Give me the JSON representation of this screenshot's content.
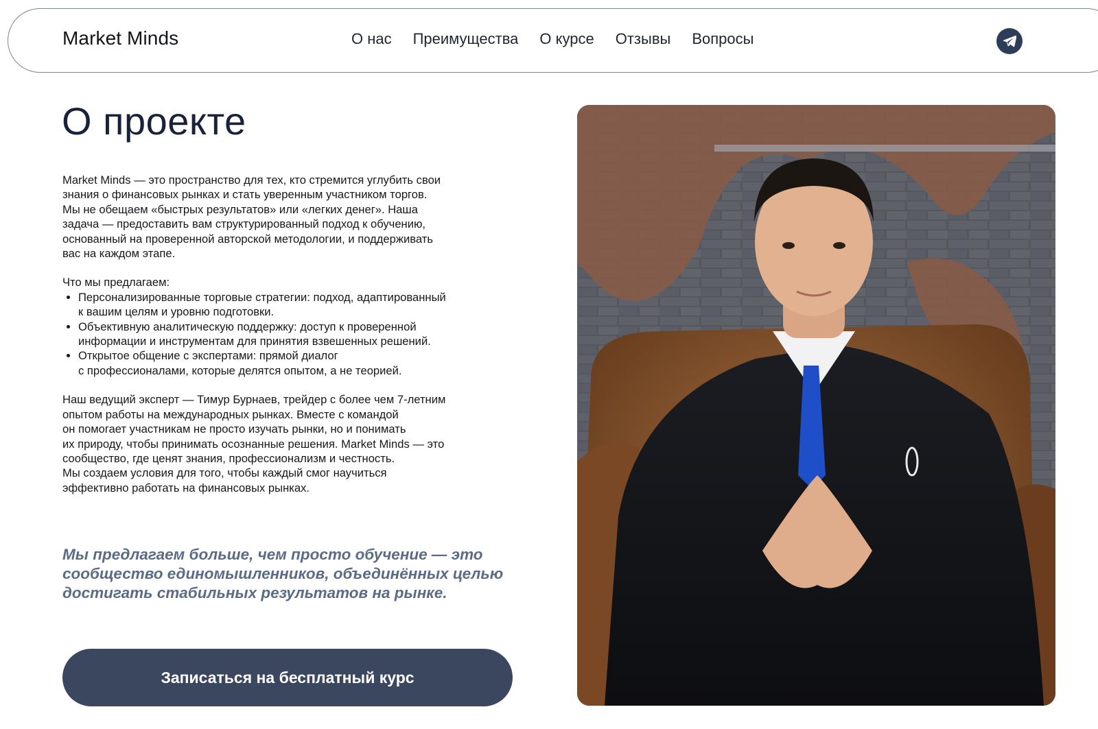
{
  "header": {
    "logo": "Market Minds",
    "nav": [
      "О нас",
      "Преимущества",
      "О курсе",
      "Отзывы",
      "Вопросы"
    ],
    "telegram_icon": "telegram-icon"
  },
  "about": {
    "title": "О проекте",
    "intro_lines": [
      "Market Minds — это пространство для тех, кто стремится углубить свои",
      "знания о финансовых рынках и стать уверенным участником торгов.",
      "Мы не обещаем «быстрых результатов» или «легких денег». Наша",
      "задача — предоставить вам структурированный подход к обучению,",
      "основанный на проверенной авторской методологии, и поддерживать",
      "вас на каждом этапе."
    ],
    "offer_heading": "Что мы предлагаем:",
    "offers": [
      [
        "Персонализированные торговые стратегии: подход, адаптированный",
        "к вашим целям и уровню подготовки."
      ],
      [
        "Объективную аналитическую поддержку: доступ к проверенной",
        "информации и инструментам для принятия взвешенных решений."
      ],
      [
        "Открытое общение с экспертами: прямой диалог",
        "с профессионалами, которые делятся опытом, а не теорией."
      ]
    ],
    "expert_lines": [
      "Наш ведущий эксперт — Тимур Бурнаев, трейдер с более чем 7-летним",
      "опытом работы на международных рынках. Вместе с командой",
      "он помогает участникам не просто изучать рынки, но и понимать",
      "их природу, чтобы принимать осознанные решения. Market Minds — это",
      "сообщество, где ценят знания, профессионализм и честность.",
      "Мы создаем условия для того, чтобы каждый смог научиться",
      "эффективно работать на финансовых рынках."
    ],
    "quote_lines": [
      "Мы предлагаем больше, чем просто обучение — это",
      "сообщество единомышленников, объединённых целью",
      "достигать стабильных результатов на рынке."
    ],
    "cta_label": "Записаться на бесплатный курс"
  },
  "colors": {
    "brand_dark": "#18223a",
    "cta_bg": "#3a475f",
    "quote": "#5a6b86",
    "telegram_bg": "#2d3d58"
  }
}
